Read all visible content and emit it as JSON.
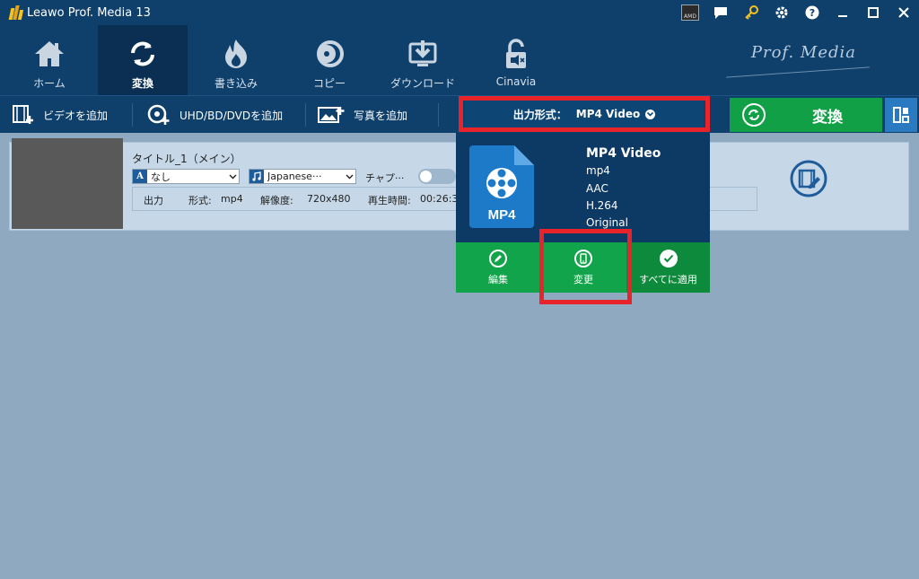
{
  "window": {
    "title": "Leawo Prof. Media 13",
    "title_icons": [
      "amd-chip-icon",
      "feedback-icon",
      "key-icon",
      "settings-icon",
      "help-icon",
      "minimize-icon",
      "maximize-icon",
      "close-icon"
    ],
    "amd_label": "AMD"
  },
  "nav": {
    "brand": "Prof. Media",
    "items": [
      {
        "label": "ホーム",
        "icon": "home-icon"
      },
      {
        "label": "変換",
        "icon": "convert-icon",
        "active": true
      },
      {
        "label": "書き込み",
        "icon": "burn-icon"
      },
      {
        "label": "コピー",
        "icon": "copy-icon"
      },
      {
        "label": "ダウンロード",
        "icon": "download-icon"
      },
      {
        "label": "Cinavia",
        "icon": "cinavia-icon"
      }
    ]
  },
  "toolbar": {
    "add_video": "ビデオを追加",
    "add_disc": "UHD/BD/DVDを追加",
    "add_photo": "写真を追加",
    "output_format_label": "出力形式：",
    "output_format_value": "MP4 Video",
    "convert_button": "変換"
  },
  "file": {
    "title": "タイトル_1（メイン）",
    "subtitle_select": "なし",
    "audio_select": "Japanese···",
    "chapter_label": "チャプ···",
    "output_label": "出力",
    "format_label": "形式:",
    "format_value": "mp4",
    "resolution_label": "解像度:",
    "resolution_value": "720x480",
    "duration_label": "再生時間:",
    "duration_value": "00:26:3"
  },
  "format_panel": {
    "tile_label": "MP4",
    "name": "MP4 Video",
    "container": "mp4",
    "audio_codec": "AAC",
    "video_codec": "H.264",
    "quality": "Original",
    "actions": [
      {
        "label": "編集",
        "icon": "pencil-icon"
      },
      {
        "label": "変更",
        "icon": "phone-icon"
      },
      {
        "label": "すべてに適用",
        "icon": "check-icon"
      }
    ]
  },
  "colors": {
    "titlebar": "#0f3f6b",
    "active_nav": "#0a2f52",
    "convert_green": "#11a046",
    "panel_green": "#12a44a",
    "panel_green_dark": "#0e8a3c",
    "highlight_red": "#e8232a",
    "background": "#8fa9c0"
  }
}
